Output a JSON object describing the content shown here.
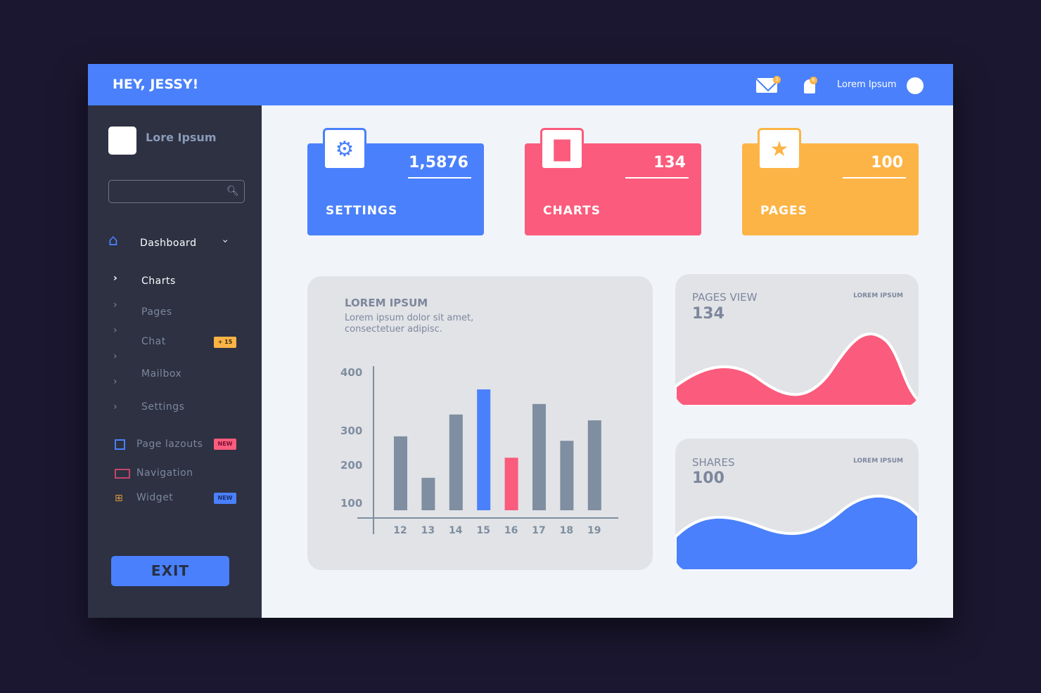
{
  "header": {
    "title": "HEY, JESSY!",
    "mail_badge": "3",
    "bell_badge": "6",
    "user_name": "Lorem Ipsum"
  },
  "sidebar": {
    "brand": "Lore Ipsum",
    "search": {
      "value": "",
      "placeholder": ""
    },
    "dashboard": "Dashboard",
    "sub_items": [
      {
        "label": "Charts",
        "active": true
      },
      {
        "label": "Pages"
      },
      {
        "label": "Chat",
        "badge": "+ 15"
      },
      {
        "label": "Mailbox"
      },
      {
        "label": "Settings"
      }
    ],
    "items": [
      {
        "label": "Page lazouts",
        "badge": "NEW",
        "icon": "layout-icon"
      },
      {
        "label": "Navigation",
        "icon": "navigation-icon"
      },
      {
        "label": "Widget",
        "badge": "NEW",
        "icon": "widget-icon"
      }
    ],
    "exit": "EXIT"
  },
  "cards": [
    {
      "label": "SETTINGS",
      "value": "1,5876",
      "color": "#4a80fb",
      "icon": "gear-icon"
    },
    {
      "label": "CHARTS",
      "value": "134",
      "color": "#fb5b7c",
      "icon": "bar-chart-icon"
    },
    {
      "label": "PAGES",
      "value": "100",
      "color": "#fdb446",
      "icon": "star-icon"
    }
  ],
  "main_chart": {
    "title": "LOREM IPSUM",
    "desc_line1": "Lorem ipsum dolor sit amet,",
    "desc_line2": "consectetuer adipisc."
  },
  "chart_data": {
    "type": "bar",
    "categories": [
      "12",
      "13",
      "14",
      "15",
      "16",
      "17",
      "18",
      "19"
    ],
    "values": [
      284,
      167,
      328,
      371,
      222,
      346,
      271,
      318
    ],
    "colors": [
      "#7f8ea0",
      "#7f8ea0",
      "#7f8ea0",
      "#4a80fb",
      "#fb5b7c",
      "#7f8ea0",
      "#7f8ea0",
      "#7f8ea0"
    ],
    "yticks": [
      "400",
      "300",
      "200",
      "100"
    ],
    "title": "",
    "xlabel": "",
    "ylabel": ""
  },
  "pages_view": {
    "title": "PAGES VIEW",
    "value": "134",
    "tag": "LOREM IPSUM",
    "color": "#fb5b7c"
  },
  "shares": {
    "title": "SHARES",
    "value": "100",
    "tag": "LOREM IPSUM",
    "color": "#4a80fb"
  }
}
